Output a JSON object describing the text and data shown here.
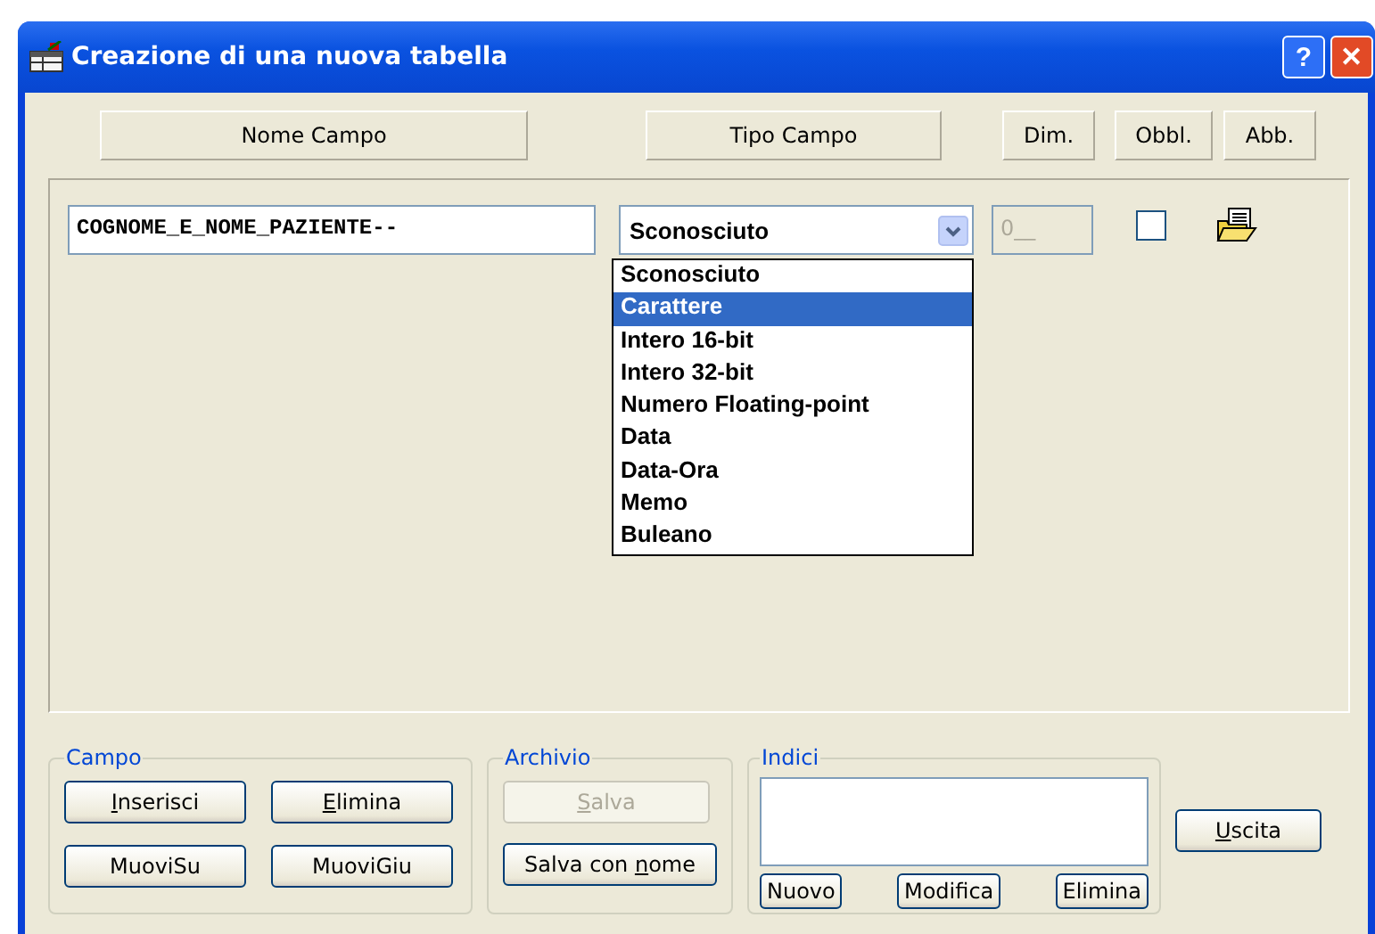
{
  "window": {
    "title": "Creazione di una nuova tabella"
  },
  "title_buttons": [
    {
      "kind": "help",
      "label": "?"
    },
    {
      "kind": "close",
      "label": "✕"
    }
  ],
  "header_buttons": [
    "Nome Campo",
    "Tipo Campo",
    "Dim.",
    "Obbl.",
    "Abb."
  ],
  "field": {
    "name": "COGNOME_E_NOME_PAZIENTE--",
    "type": "Sconosciuto",
    "size": "0__",
    "size_disabled": true,
    "required": false
  },
  "type_dropdown": {
    "expanded": true,
    "options": [
      {
        "label": "Sconosciuto",
        "selected": false
      },
      {
        "label": "Carattere",
        "selected": true
      },
      {
        "label": "Intero 16-bit",
        "selected": false
      },
      {
        "label": "Intero 32-bit",
        "selected": false
      },
      {
        "label": "Numero Floating-point",
        "selected": false
      },
      {
        "label": "Data",
        "selected": false
      },
      {
        "label": "Data-Ora",
        "selected": false
      },
      {
        "label": "Memo",
        "selected": false
      },
      {
        "label": "Buleano",
        "selected": false
      }
    ]
  },
  "campo": {
    "title": "Campo",
    "buttons": [
      {
        "label_parts": [
          {
            "text": "I",
            "underline": true
          },
          {
            "text": "nserisci",
            "underline": false
          }
        ],
        "disabled": false
      },
      {
        "label_parts": [
          {
            "text": "E",
            "underline": true
          },
          {
            "text": "limina",
            "underline": false
          }
        ],
        "disabled": false
      },
      {
        "label_parts": [
          {
            "text": "MuoviSu",
            "underline": false
          }
        ],
        "disabled": false
      },
      {
        "label_parts": [
          {
            "text": "MuoviGiu",
            "underline": false
          }
        ],
        "disabled": false
      }
    ]
  },
  "archivio": {
    "title": "Archivio",
    "buttons": [
      {
        "label_parts": [
          {
            "text": "S",
            "underline": true
          },
          {
            "text": "alva",
            "underline": false
          }
        ],
        "disabled": true
      },
      {
        "label_parts": [
          {
            "text": "Salva con ",
            "underline": false
          },
          {
            "text": "n",
            "underline": true
          },
          {
            "text": "ome",
            "underline": false
          }
        ],
        "disabled": false
      }
    ]
  },
  "indici": {
    "title": "Indici",
    "buttons": [
      {
        "label": "Nuovo",
        "disabled": false
      },
      {
        "label": "Modifica",
        "disabled": false
      },
      {
        "label": "Elimina",
        "disabled": false
      }
    ]
  },
  "exit_button": {
    "label_parts": [
      {
        "text": "U",
        "underline": true
      },
      {
        "text": "scita",
        "underline": false
      }
    ],
    "disabled": false
  }
}
